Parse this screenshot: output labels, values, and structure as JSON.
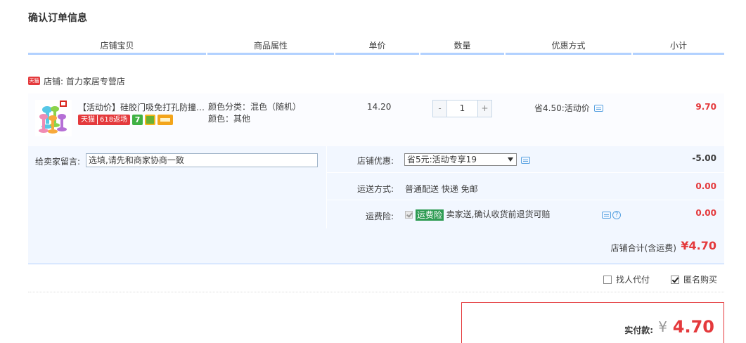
{
  "page": {
    "title": "确认订单信息"
  },
  "columns": [
    {
      "label": "店铺宝贝"
    },
    {
      "label": "商品属性"
    },
    {
      "label": "单价"
    },
    {
      "label": "数量"
    },
    {
      "label": "优惠方式"
    },
    {
      "label": "小计"
    }
  ],
  "shop": {
    "badge": "天猫",
    "label": "店铺: 首力家居专营店"
  },
  "item": {
    "title": "【活动价】硅胶门吸免打孔防撞门挡",
    "tag_tmall": "天猫",
    "tag_618": "618返场",
    "tag_7": "7",
    "attr_1": "颜色分类：混色（随机）",
    "attr_2": "颜色：其他",
    "unit_price": "14.20",
    "qty_minus": "-",
    "qty_value": "1",
    "qty_plus": "+",
    "promo": "省4.50:活动价",
    "subtotal": "9.70"
  },
  "details": {
    "memo_label": "给卖家留言:",
    "memo_placeholder": "选填,请先和商家协商一致",
    "shop_discount_label": "店铺优惠:",
    "shop_discount_value": "省5元:活动专享19",
    "shop_discount_amount": "-5.00",
    "shipping_label": "运送方式:",
    "shipping_value": "普通配送 快递 免邮",
    "shipping_amount": "0.00",
    "insurance_label": "运费险:",
    "insurance_badge": "运费险",
    "insurance_text": "卖家送,确认收货前退货可赔",
    "insurance_amount": "0.00"
  },
  "shop_total": {
    "label": "店铺合计(含运费)",
    "amount": "¥4.70"
  },
  "options": {
    "pay_for_me_label": "找人代付",
    "anonymous_label": "匿名购买",
    "anonymous_checked": true
  },
  "payment": {
    "label": "实付款:",
    "currency": "¥",
    "amount": "4.70"
  },
  "colors": {
    "accent": "#e4393c",
    "header_line": "#b2d1ff",
    "block_bg": "#f2f7ff",
    "insurance_green": "#2e9b53"
  }
}
